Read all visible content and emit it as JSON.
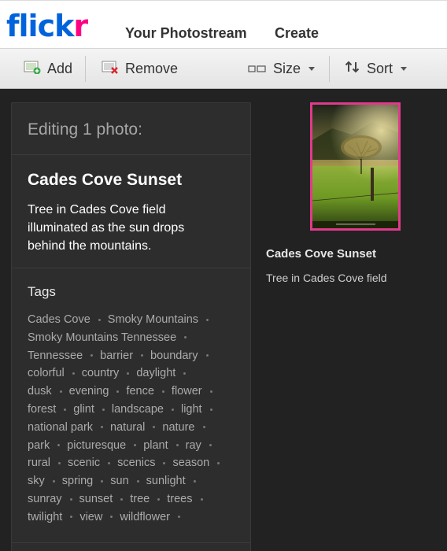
{
  "header": {
    "logo_part1": "flick",
    "logo_part2": "r",
    "nav": [
      "Your Photostream",
      "Create"
    ]
  },
  "toolbar": {
    "add_label": "Add",
    "remove_label": "Remove",
    "size_label": "Size",
    "sort_label": "Sort"
  },
  "editor": {
    "heading": "Editing 1 photo:",
    "photo_title": "Cades Cove Sunset",
    "photo_description": "Tree in Cades Cove field illuminated as the sun drops behind the mountains.",
    "tags_label": "Tags",
    "tag_lines": [
      [
        "Cades Cove",
        "Smoky Mountains"
      ],
      [
        "Smoky Mountains Tennessee"
      ],
      [
        "Tennessee",
        "barrier",
        "boundary"
      ],
      [
        "colorful",
        "country",
        "daylight"
      ],
      [
        "dusk",
        "evening",
        "fence",
        "flower"
      ],
      [
        "forest",
        "glint",
        "landscape",
        "light"
      ],
      [
        "national park",
        "natural",
        "nature"
      ],
      [
        "park",
        "picturesque",
        "plant",
        "ray"
      ],
      [
        "rural",
        "scenic",
        "scenics",
        "season"
      ],
      [
        "sky",
        "spring",
        "sun",
        "sunlight"
      ],
      [
        "sunray",
        "sunset",
        "tree",
        "trees"
      ],
      [
        "twilight",
        "view",
        "wildflower"
      ]
    ]
  },
  "selected_photo": {
    "title": "Cades Cove Sunset",
    "description": "Tree in Cades Cove field"
  },
  "colors": {
    "flickr_blue": "#0063dc",
    "flickr_pink": "#ff0084",
    "selection_border": "#e03a8b",
    "background": "#222222"
  },
  "icons": {
    "add": "add-photo-icon",
    "remove": "remove-photo-icon",
    "size": "size-icon",
    "sort": "sort-icon"
  }
}
